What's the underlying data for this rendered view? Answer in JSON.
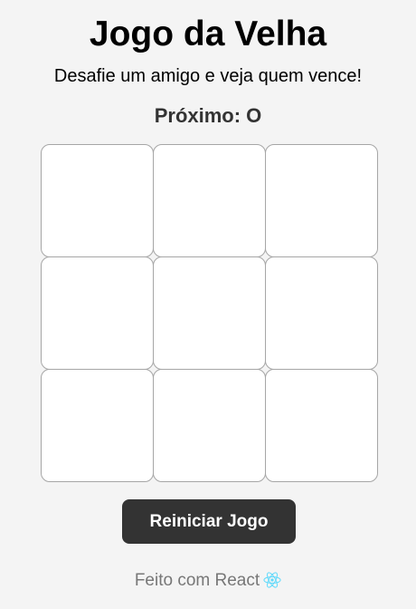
{
  "header": {
    "title": "Jogo da Velha",
    "subtitle": "Desafie um amigo e veja quem vence!"
  },
  "status": {
    "text": "Próximo: O"
  },
  "board": {
    "cells": [
      "",
      "",
      "",
      "",
      "",
      "",
      "",
      "",
      ""
    ]
  },
  "controls": {
    "reset_label": "Reiniciar Jogo"
  },
  "footer": {
    "text": "Feito com React",
    "icon": "react-icon",
    "icon_color": "#61dafb"
  },
  "colors": {
    "background": "#f4f4f4",
    "button": "#333333",
    "cell_border": "#a6a6a6"
  }
}
